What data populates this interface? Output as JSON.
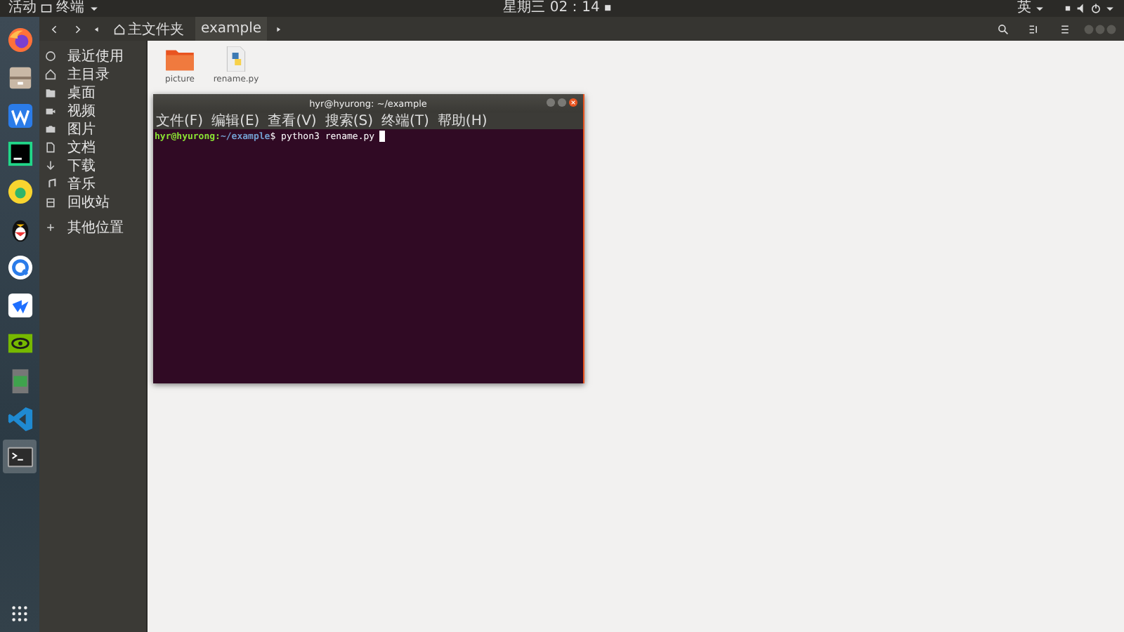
{
  "top_bar": {
    "activities": "活动",
    "app_menu": "终端",
    "clock": "星期三 02：14",
    "input_method": "英"
  },
  "dock": [
    {
      "kind": "browser",
      "selected": false
    },
    {
      "kind": "files",
      "selected": false
    },
    {
      "kind": "wps",
      "selected": false
    },
    {
      "kind": "ide",
      "selected": false
    },
    {
      "kind": "music",
      "selected": false
    },
    {
      "kind": "penguin",
      "selected": false
    },
    {
      "kind": "qcircle",
      "selected": false
    },
    {
      "kind": "bluebird",
      "selected": false
    },
    {
      "kind": "eye",
      "selected": false
    },
    {
      "kind": "sheet",
      "selected": false
    },
    {
      "kind": "code",
      "selected": false
    },
    {
      "kind": "terminal",
      "selected": true
    }
  ],
  "file_manager": {
    "path": [
      {
        "label": "主文件夹",
        "kind": "home",
        "selected": false
      },
      {
        "label": "example",
        "kind": "folder",
        "selected": true
      }
    ],
    "sidebar": [
      {
        "label": "最近使用",
        "kind": "recent"
      },
      {
        "label": "主目录",
        "kind": "home"
      },
      {
        "label": "桌面",
        "kind": "folder"
      },
      {
        "label": "视频",
        "kind": "video"
      },
      {
        "label": "图片",
        "kind": "camera"
      },
      {
        "label": "文档",
        "kind": "document"
      },
      {
        "label": "下载",
        "kind": "download"
      },
      {
        "label": "音乐",
        "kind": "music"
      },
      {
        "label": "回收站",
        "kind": "trash"
      },
      {
        "label": "其他位置",
        "kind": "add"
      }
    ],
    "files": [
      {
        "name": "picture",
        "kind": "folder"
      },
      {
        "name": "rename.py",
        "kind": "python"
      }
    ]
  },
  "terminal": {
    "title": "hyr@hyurong: ~/example",
    "menu": [
      "文件(F)",
      "编辑(E)",
      "查看(V)",
      "搜索(S)",
      "终端(T)",
      "帮助(H)"
    ],
    "prompt_user": "hyr@hyurong:",
    "prompt_path": "~/example",
    "command": "$ python3 rename.py"
  }
}
